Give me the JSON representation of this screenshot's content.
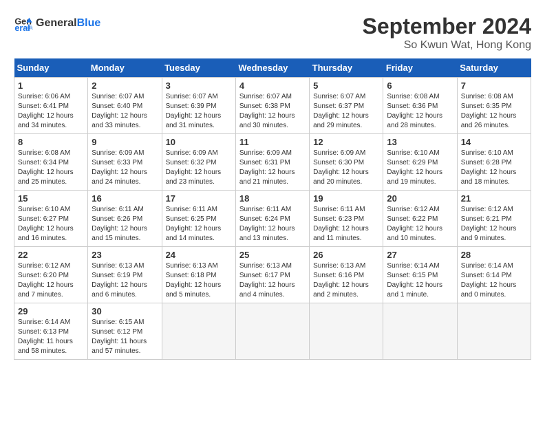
{
  "logo": {
    "text1": "General",
    "text2": "Blue"
  },
  "title": "September 2024",
  "location": "So Kwun Wat, Hong Kong",
  "headers": [
    "Sunday",
    "Monday",
    "Tuesday",
    "Wednesday",
    "Thursday",
    "Friday",
    "Saturday"
  ],
  "weeks": [
    [
      {
        "day": "1",
        "info": "Sunrise: 6:06 AM\nSunset: 6:41 PM\nDaylight: 12 hours\nand 34 minutes."
      },
      {
        "day": "2",
        "info": "Sunrise: 6:07 AM\nSunset: 6:40 PM\nDaylight: 12 hours\nand 33 minutes."
      },
      {
        "day": "3",
        "info": "Sunrise: 6:07 AM\nSunset: 6:39 PM\nDaylight: 12 hours\nand 31 minutes."
      },
      {
        "day": "4",
        "info": "Sunrise: 6:07 AM\nSunset: 6:38 PM\nDaylight: 12 hours\nand 30 minutes."
      },
      {
        "day": "5",
        "info": "Sunrise: 6:07 AM\nSunset: 6:37 PM\nDaylight: 12 hours\nand 29 minutes."
      },
      {
        "day": "6",
        "info": "Sunrise: 6:08 AM\nSunset: 6:36 PM\nDaylight: 12 hours\nand 28 minutes."
      },
      {
        "day": "7",
        "info": "Sunrise: 6:08 AM\nSunset: 6:35 PM\nDaylight: 12 hours\nand 26 minutes."
      }
    ],
    [
      {
        "day": "8",
        "info": "Sunrise: 6:08 AM\nSunset: 6:34 PM\nDaylight: 12 hours\nand 25 minutes."
      },
      {
        "day": "9",
        "info": "Sunrise: 6:09 AM\nSunset: 6:33 PM\nDaylight: 12 hours\nand 24 minutes."
      },
      {
        "day": "10",
        "info": "Sunrise: 6:09 AM\nSunset: 6:32 PM\nDaylight: 12 hours\nand 23 minutes."
      },
      {
        "day": "11",
        "info": "Sunrise: 6:09 AM\nSunset: 6:31 PM\nDaylight: 12 hours\nand 21 minutes."
      },
      {
        "day": "12",
        "info": "Sunrise: 6:09 AM\nSunset: 6:30 PM\nDaylight: 12 hours\nand 20 minutes."
      },
      {
        "day": "13",
        "info": "Sunrise: 6:10 AM\nSunset: 6:29 PM\nDaylight: 12 hours\nand 19 minutes."
      },
      {
        "day": "14",
        "info": "Sunrise: 6:10 AM\nSunset: 6:28 PM\nDaylight: 12 hours\nand 18 minutes."
      }
    ],
    [
      {
        "day": "15",
        "info": "Sunrise: 6:10 AM\nSunset: 6:27 PM\nDaylight: 12 hours\nand 16 minutes."
      },
      {
        "day": "16",
        "info": "Sunrise: 6:11 AM\nSunset: 6:26 PM\nDaylight: 12 hours\nand 15 minutes."
      },
      {
        "day": "17",
        "info": "Sunrise: 6:11 AM\nSunset: 6:25 PM\nDaylight: 12 hours\nand 14 minutes."
      },
      {
        "day": "18",
        "info": "Sunrise: 6:11 AM\nSunset: 6:24 PM\nDaylight: 12 hours\nand 13 minutes."
      },
      {
        "day": "19",
        "info": "Sunrise: 6:11 AM\nSunset: 6:23 PM\nDaylight: 12 hours\nand 11 minutes."
      },
      {
        "day": "20",
        "info": "Sunrise: 6:12 AM\nSunset: 6:22 PM\nDaylight: 12 hours\nand 10 minutes."
      },
      {
        "day": "21",
        "info": "Sunrise: 6:12 AM\nSunset: 6:21 PM\nDaylight: 12 hours\nand 9 minutes."
      }
    ],
    [
      {
        "day": "22",
        "info": "Sunrise: 6:12 AM\nSunset: 6:20 PM\nDaylight: 12 hours\nand 7 minutes."
      },
      {
        "day": "23",
        "info": "Sunrise: 6:13 AM\nSunset: 6:19 PM\nDaylight: 12 hours\nand 6 minutes."
      },
      {
        "day": "24",
        "info": "Sunrise: 6:13 AM\nSunset: 6:18 PM\nDaylight: 12 hours\nand 5 minutes."
      },
      {
        "day": "25",
        "info": "Sunrise: 6:13 AM\nSunset: 6:17 PM\nDaylight: 12 hours\nand 4 minutes."
      },
      {
        "day": "26",
        "info": "Sunrise: 6:13 AM\nSunset: 6:16 PM\nDaylight: 12 hours\nand 2 minutes."
      },
      {
        "day": "27",
        "info": "Sunrise: 6:14 AM\nSunset: 6:15 PM\nDaylight: 12 hours\nand 1 minute."
      },
      {
        "day": "28",
        "info": "Sunrise: 6:14 AM\nSunset: 6:14 PM\nDaylight: 12 hours\nand 0 minutes."
      }
    ],
    [
      {
        "day": "29",
        "info": "Sunrise: 6:14 AM\nSunset: 6:13 PM\nDaylight: 11 hours\nand 58 minutes."
      },
      {
        "day": "30",
        "info": "Sunrise: 6:15 AM\nSunset: 6:12 PM\nDaylight: 11 hours\nand 57 minutes."
      },
      {
        "day": "",
        "info": ""
      },
      {
        "day": "",
        "info": ""
      },
      {
        "day": "",
        "info": ""
      },
      {
        "day": "",
        "info": ""
      },
      {
        "day": "",
        "info": ""
      }
    ]
  ]
}
